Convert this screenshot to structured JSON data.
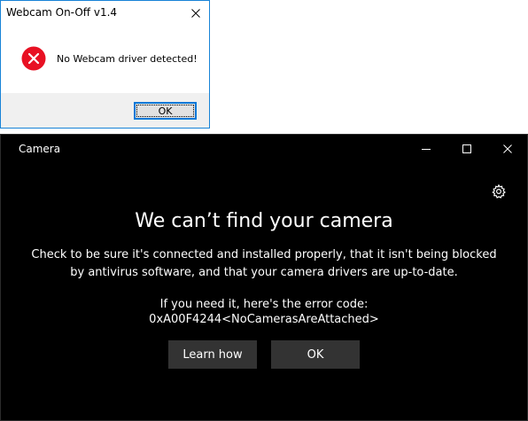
{
  "dialog": {
    "title": "Webcam On-Off v1.4",
    "message": "No Webcam driver detected!",
    "ok_label": "OK",
    "icons": {
      "close": "close-icon",
      "error": "error-icon"
    },
    "colors": {
      "error_red": "#e81123",
      "border": "#1883d7"
    }
  },
  "camera": {
    "title": "Camera",
    "headline": "We can’t find your camera",
    "body_line1": "Check to be sure it's connected and installed properly, that it isn't being blocked",
    "body_line2": "by antivirus software, and that your camera drivers are up-to-date.",
    "error_label": "If you need it, here's the error code:",
    "error_code": "0xA00F4244<NoCamerasAreAttached>",
    "learn_how_label": "Learn how",
    "ok_label": "OK",
    "icons": {
      "minimize": "minimize-icon",
      "maximize": "maximize-icon",
      "close": "close-icon",
      "settings": "gear-icon"
    },
    "colors": {
      "background": "#000000",
      "button": "#333333",
      "text": "#ffffff"
    }
  }
}
